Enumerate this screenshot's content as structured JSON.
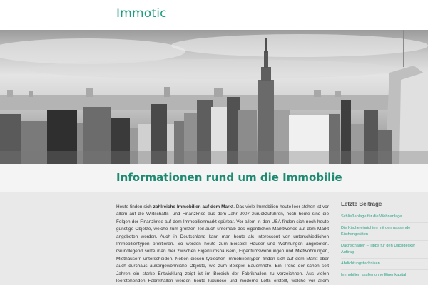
{
  "header": {
    "site_title": "Immotic"
  },
  "hero": {
    "image": "city-skyline-photo"
  },
  "page": {
    "heading": "Informationen rund um die Immobilie"
  },
  "article": {
    "intro_before": "Heute finden sich ",
    "intro_bold": "zahlreiche Immobilien auf dem Markt",
    "body": ". Das viele Immobilien heute leer stehen ist vor allem auf die Wirtschafts- und Finanzkrise aus dem Jahr 2007 zurückzuführen, noch heute sind die Folgen der Finanzkrise auf dem Immobilienmarkt spürbar. Vor allem in den USA finden sich noch heute günstige Objekte, welche zum größten Teil auch unterhalb des eigentlichen Marktwertes auf dem Markt angeboten werden. Auch in Deutschland kann man heute als Interessent von unterschiedlichen Immobilientypen profitieren. So werden heute zum Beispiel Häuser und Wohnungen angeboten. Grundlegend sollte man hier zwischen Eigentumshäusern, Eigentumswohnungen und Mietwohnungen, Miethäusern unterscheiden. Neben diesen typischen Immobilientypen finden sich auf dem Markt aber auch durchaus außergewöhnliche Objekte, wie zum Beispiel Bauernhöfe. Ein Trend der schon seit Jahren ein starke Entwicklung zeigt ist im Bereich der Fabrikhallen zu verzeichnen. Aus vielen leerstehenden Fabrikhallen werden heute luxuriöse und moderne Lofts erstellt, welche vor allem gehobenen Ansprüchen"
  },
  "sidebar": {
    "heading": "Letzte Beiträge",
    "items": [
      {
        "label": "Schließanlage für die Wohnanlage"
      },
      {
        "label": "Die Küche einrichten mit den passende Küchengeräten"
      },
      {
        "label": "Dachschaden – Tipps für den Dachdecker Auftrag"
      },
      {
        "label": "Abdichtungstechniken"
      },
      {
        "label": "Immobilien kaufen ohne Eigenkapital"
      }
    ]
  }
}
